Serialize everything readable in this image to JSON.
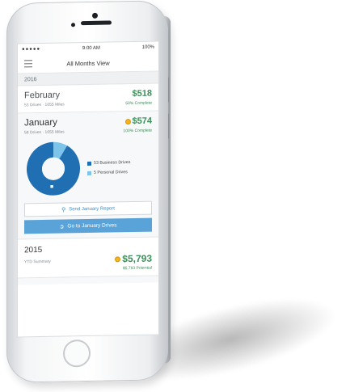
{
  "status_bar": {
    "carrier": "●●●●● ",
    "time": "9:00 AM",
    "battery": "100%"
  },
  "nav": {
    "title": "All Months View",
    "menu_icon": "hamburger-icon"
  },
  "year_header": "2016",
  "months": [
    {
      "name": "February",
      "detail": "53 Drives · 1055 Miles",
      "value": "$518",
      "status": "50% Complete"
    },
    {
      "name": "January",
      "detail": "58 Drives · 1055 Miles",
      "value": "$574",
      "status": "100% Complete"
    }
  ],
  "january_chart": {
    "business_label": "53 Business Drives",
    "personal_label": "5 Personal Drives",
    "colors": {
      "business": "#1f6fb2",
      "personal": "#7cc4ea"
    }
  },
  "chart_data": {
    "type": "pie",
    "categories": [
      "Business Drives",
      "Personal Drives"
    ],
    "values": [
      53,
      5
    ],
    "title": "",
    "legend": "right"
  },
  "actions": {
    "report": "Send January Report",
    "drives": "Go to January Drives"
  },
  "summary": {
    "year": "2015",
    "label": "YTD Summary",
    "value": "$5,793",
    "potential": "$5,793 Potential"
  },
  "colors": {
    "green": "#3e8e5a",
    "accent": "#5aa3d8",
    "coin": "#f2b51c"
  }
}
